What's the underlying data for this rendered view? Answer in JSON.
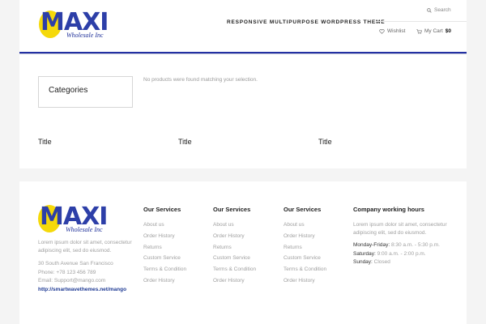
{
  "header": {
    "logo": {
      "word": "MAXI",
      "sub": "Wholesale Inc"
    },
    "tagline": "RESPONSIVE MULTIPURPOSE WORDPRESS THEME",
    "search_label": "Search",
    "wishlist_label": "Wishlist",
    "cart_label": "My Cart",
    "cart_amount": "$0",
    "icons": [
      "search-icon",
      "heart-icon",
      "cart-icon"
    ]
  },
  "main": {
    "categories_title": "Categories",
    "no_products": "No products were found matching your selection.",
    "columns": [
      "Title",
      "Title",
      "Title"
    ]
  },
  "footer": {
    "logo": {
      "word": "MAXI",
      "sub": "Wholesale Inc"
    },
    "description": "Lorem ipsum dolor sit amet, consectetur adipiscing elit, sed do eiusmod.",
    "address": "30 South Avenue San Francisco",
    "phone": "Phone: +78 123 456 789",
    "email": "Email: Support@mango.com",
    "link": "http://smartwavethemes.net/mango",
    "services": [
      {
        "title": "Our Services",
        "items": [
          "About us",
          "Order History",
          "Returns",
          "Custom Service",
          "Terms & Condition",
          "Order History"
        ]
      },
      {
        "title": "Our Services",
        "items": [
          "About us",
          "Order History",
          "Returns",
          "Custom Service",
          "Terms & Condition",
          "Order History"
        ]
      },
      {
        "title": "Our Services",
        "items": [
          "About us",
          "Order History",
          "Returns",
          "Custom Service",
          "Terms & Condition",
          "Order History"
        ]
      }
    ],
    "hours": {
      "title": "Company working hours",
      "description": "Lorem ipsum dolor sit amet, consectetur adipiscing elit, sed do eiusmod.",
      "rows": [
        {
          "day": "Monday-Friday:",
          "time": "8:30 a.m. - 5:30 p.m."
        },
        {
          "day": "Saturday:",
          "time": "9:00 a.m. - 2:00 p.m."
        },
        {
          "day": "Sunday:",
          "time": "Closed"
        }
      ]
    }
  },
  "colors": {
    "accent": "#2330a3",
    "logo_yellow": "#f5d90a",
    "logo_blue": "#2d3fa8",
    "link": "#1e3a94"
  }
}
